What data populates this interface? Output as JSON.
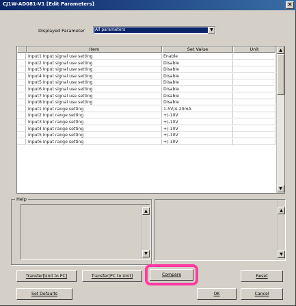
{
  "window": {
    "title": "CJ1W-AD081-V1 [Edit Parameters]",
    "close_glyph": "×"
  },
  "filter": {
    "label": "Displayed Parameter",
    "value": "All parameters",
    "arrow_glyph": "▼"
  },
  "grid": {
    "columns": [
      "Item",
      "Set Value",
      "Unit"
    ],
    "rows": [
      {
        "item": "Input1 Input signal use setting",
        "value": "Enable",
        "unit": ""
      },
      {
        "item": "Input2 Input signal use setting",
        "value": "Disable",
        "unit": ""
      },
      {
        "item": "Input3 Input signal use setting",
        "value": "Disable",
        "unit": ""
      },
      {
        "item": "Input4 Input signal use setting",
        "value": "Disable",
        "unit": ""
      },
      {
        "item": "Input5 Input signal use setting",
        "value": "Disable",
        "unit": ""
      },
      {
        "item": "Input6 Input signal use setting",
        "value": "Disable",
        "unit": ""
      },
      {
        "item": "Input7 Input signal use setting",
        "value": "Disable",
        "unit": ""
      },
      {
        "item": "Input8 Input signal use setting",
        "value": "Disable",
        "unit": ""
      },
      {
        "item": "Input1 Input range setting",
        "value": "1-5V/4-20mA",
        "unit": ""
      },
      {
        "item": "Input2 Input range setting",
        "value": "+/-10V",
        "unit": ""
      },
      {
        "item": "Input3 Input range setting",
        "value": "+/-10V",
        "unit": ""
      },
      {
        "item": "Input4 Input range setting",
        "value": "+/-10V",
        "unit": ""
      },
      {
        "item": "Input5 Input range setting",
        "value": "+/-10V",
        "unit": ""
      },
      {
        "item": "Input6 Input range setting",
        "value": "+/-10V",
        "unit": ""
      }
    ],
    "scroll_up_glyph": "▲",
    "scroll_down_glyph": "▼"
  },
  "help": {
    "label": "Help",
    "up_glyph": "▲",
    "down_glyph": "▼"
  },
  "buttons": {
    "transfer_to_pc": "Transfer[Unit to PC]",
    "transfer_to_unit": "Transfer[PC to Unit]",
    "compare": "Compare",
    "reset": "Reset",
    "set_defaults": "Set Defaults",
    "ok": "OK",
    "cancel": "Cancel"
  },
  "colors": {
    "titlebar": "#0a246a",
    "highlight": "#ff3aa0",
    "face": "#d4d0c8"
  }
}
